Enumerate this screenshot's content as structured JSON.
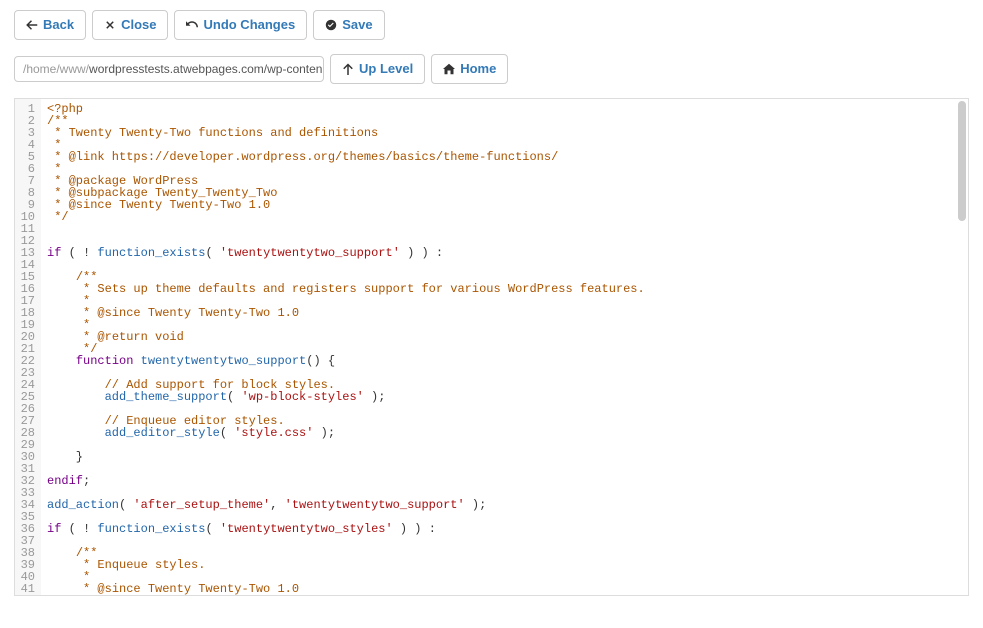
{
  "toolbar": {
    "back": "Back",
    "close": "Close",
    "undo": "Undo Changes",
    "save": "Save"
  },
  "path": {
    "prefix": "/home/www/",
    "main": "wordpresstests.atwebpages.com/wp-conten",
    "uplevel": "Up Level",
    "home": "Home"
  },
  "code": {
    "lines": [
      [
        [
          "c-tag",
          "<?php"
        ]
      ],
      [
        [
          "c-com",
          "/**"
        ]
      ],
      [
        [
          "c-com",
          " * Twenty Twenty-Two functions and definitions"
        ]
      ],
      [
        [
          "c-com",
          " *"
        ]
      ],
      [
        [
          "c-com",
          " * @link https://developer.wordpress.org/themes/basics/theme-functions/"
        ]
      ],
      [
        [
          "c-com",
          " *"
        ]
      ],
      [
        [
          "c-com",
          " * @package WordPress"
        ]
      ],
      [
        [
          "c-com",
          " * @subpackage Twenty_Twenty_Two"
        ]
      ],
      [
        [
          "c-com",
          " * @since Twenty Twenty-Two 1.0"
        ]
      ],
      [
        [
          "c-com",
          " */"
        ]
      ],
      [
        [
          "",
          ""
        ]
      ],
      [
        [
          "",
          ""
        ]
      ],
      [
        [
          "c-kw",
          "if"
        ],
        "",
        " ( ! ",
        [
          "c-fn",
          "function_exists"
        ],
        "( ",
        [
          "c-str",
          "'twentytwentytwo_support'"
        ],
        " ) ) :"
      ],
      [
        [
          "",
          ""
        ]
      ],
      [
        [
          "",
          "    "
        ],
        [
          "c-com",
          "/**"
        ]
      ],
      [
        [
          "",
          "    "
        ],
        [
          "c-com",
          " * Sets up theme defaults and registers support for various WordPress features."
        ]
      ],
      [
        [
          "",
          "    "
        ],
        [
          "c-com",
          " *"
        ]
      ],
      [
        [
          "",
          "    "
        ],
        [
          "c-com",
          " * @since Twenty Twenty-Two 1.0"
        ]
      ],
      [
        [
          "",
          "    "
        ],
        [
          "c-com",
          " *"
        ]
      ],
      [
        [
          "",
          "    "
        ],
        [
          "c-com",
          " * @return void"
        ]
      ],
      [
        [
          "",
          "    "
        ],
        [
          "c-com",
          " */"
        ]
      ],
      [
        [
          "",
          "    "
        ],
        [
          "c-kw",
          "function"
        ],
        "",
        " ",
        [
          "c-fn",
          "twentytwentytwo_support"
        ],
        "() {"
      ],
      [
        [
          "",
          ""
        ]
      ],
      [
        [
          "",
          "        "
        ],
        [
          "c-com",
          "// Add support for block styles."
        ]
      ],
      [
        [
          "",
          "        "
        ],
        [
          "c-fn",
          "add_theme_support"
        ],
        "( ",
        [
          "c-str",
          "'wp-block-styles'"
        ],
        " );"
      ],
      [
        [
          "",
          ""
        ]
      ],
      [
        [
          "",
          "        "
        ],
        [
          "c-com",
          "// Enqueue editor styles."
        ]
      ],
      [
        [
          "",
          "        "
        ],
        [
          "c-fn",
          "add_editor_style"
        ],
        "( ",
        [
          "c-str",
          "'style.css'"
        ],
        " );"
      ],
      [
        [
          "",
          ""
        ]
      ],
      [
        [
          "",
          "    }"
        ]
      ],
      [
        [
          "",
          ""
        ]
      ],
      [
        [
          "c-kw",
          "endif"
        ],
        ";"
      ],
      [
        [
          "",
          ""
        ]
      ],
      [
        [
          "c-fn",
          "add_action"
        ],
        "( ",
        [
          "c-str",
          "'after_setup_theme'"
        ],
        ", ",
        [
          "c-str",
          "'twentytwentytwo_support'"
        ],
        " );"
      ],
      [
        [
          "",
          ""
        ]
      ],
      [
        [
          "c-kw",
          "if"
        ],
        "",
        " ( ! ",
        [
          "c-fn",
          "function_exists"
        ],
        "( ",
        [
          "c-str",
          "'twentytwentytwo_styles'"
        ],
        " ) ) :"
      ],
      [
        [
          "",
          ""
        ]
      ],
      [
        [
          "",
          "    "
        ],
        [
          "c-com",
          "/**"
        ]
      ],
      [
        [
          "",
          "    "
        ],
        [
          "c-com",
          " * Enqueue styles."
        ]
      ],
      [
        [
          "",
          "    "
        ],
        [
          "c-com",
          " *"
        ]
      ],
      [
        [
          "",
          "    "
        ],
        [
          "c-com",
          " * @since Twenty Twenty-Two 1.0"
        ]
      ]
    ]
  }
}
